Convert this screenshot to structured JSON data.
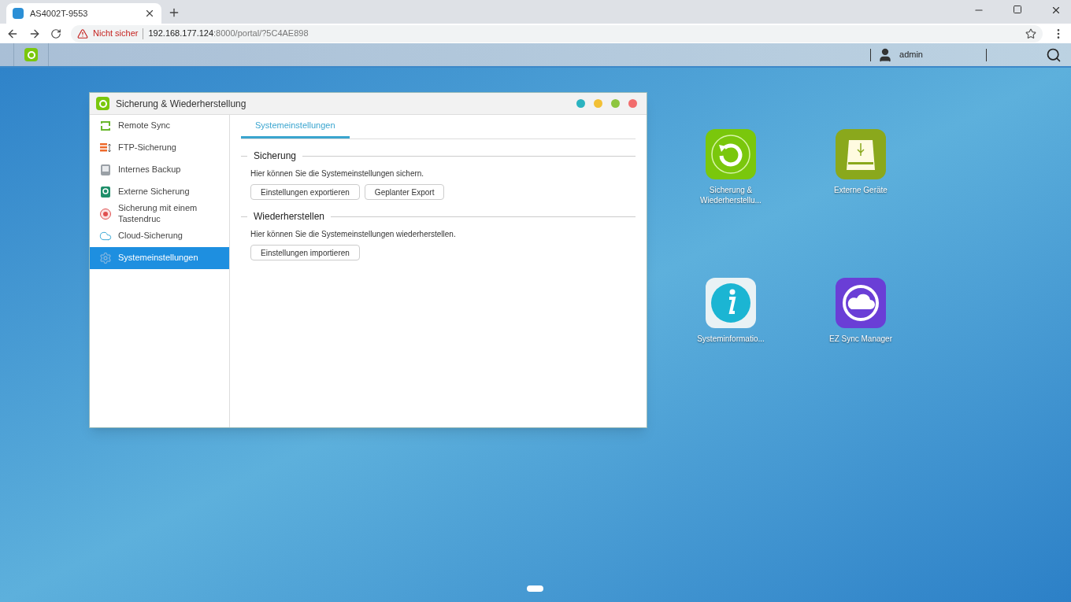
{
  "browser": {
    "tab": {
      "title": "AS4002T-9553"
    },
    "security": "Nicht sicher",
    "url_host": "192.168.177.124",
    "url_rest": ":8000/portal/?5C4AE898"
  },
  "taskbar": {
    "user": "admin"
  },
  "window": {
    "title": "Sicherung & Wiederherstellung",
    "controls": [
      {
        "color": "#2bb3c0"
      },
      {
        "color": "#f2c035"
      },
      {
        "color": "#8dc63f"
      },
      {
        "color": "#f26d6d"
      }
    ],
    "sidebar": {
      "items": [
        {
          "label": "Remote Sync",
          "kind": "sync",
          "selected": false
        },
        {
          "label": "FTP-Sicherung",
          "kind": "ftp",
          "selected": false
        },
        {
          "label": "Internes Backup",
          "kind": "drive",
          "selected": false
        },
        {
          "label": "Externe Sicherung",
          "kind": "external",
          "selected": false
        },
        {
          "label": "Sicherung mit einem Tastendruc",
          "kind": "button",
          "selected": false
        },
        {
          "label": "Cloud-Sicherung",
          "kind": "cloud",
          "selected": false
        },
        {
          "label": "Systemeinstellungen",
          "kind": "gear",
          "selected": true
        }
      ]
    },
    "tabs": [
      {
        "label": "Systemeinstellungen",
        "selected": true
      }
    ],
    "sections": [
      {
        "title": "Sicherung",
        "description": "Hier können Sie die Systemeinstellungen sichern.",
        "buttons": [
          "Einstellungen exportieren",
          "Geplanter Export"
        ]
      },
      {
        "title": "Wiederherstellen",
        "description": "Hier können Sie die Systemeinstellungen wiederherstellen.",
        "buttons": [
          "Einstellungen importieren"
        ]
      }
    ]
  },
  "desktop": {
    "icons": [
      {
        "label": "Sicherung & Wiederherstellu...",
        "kind": "backup"
      },
      {
        "label": "Externe Geräte",
        "kind": "usb"
      },
      {
        "label": "Systeminformatio...",
        "kind": "info"
      },
      {
        "label": "EZ Sync Manager",
        "kind": "ezsync"
      }
    ]
  }
}
